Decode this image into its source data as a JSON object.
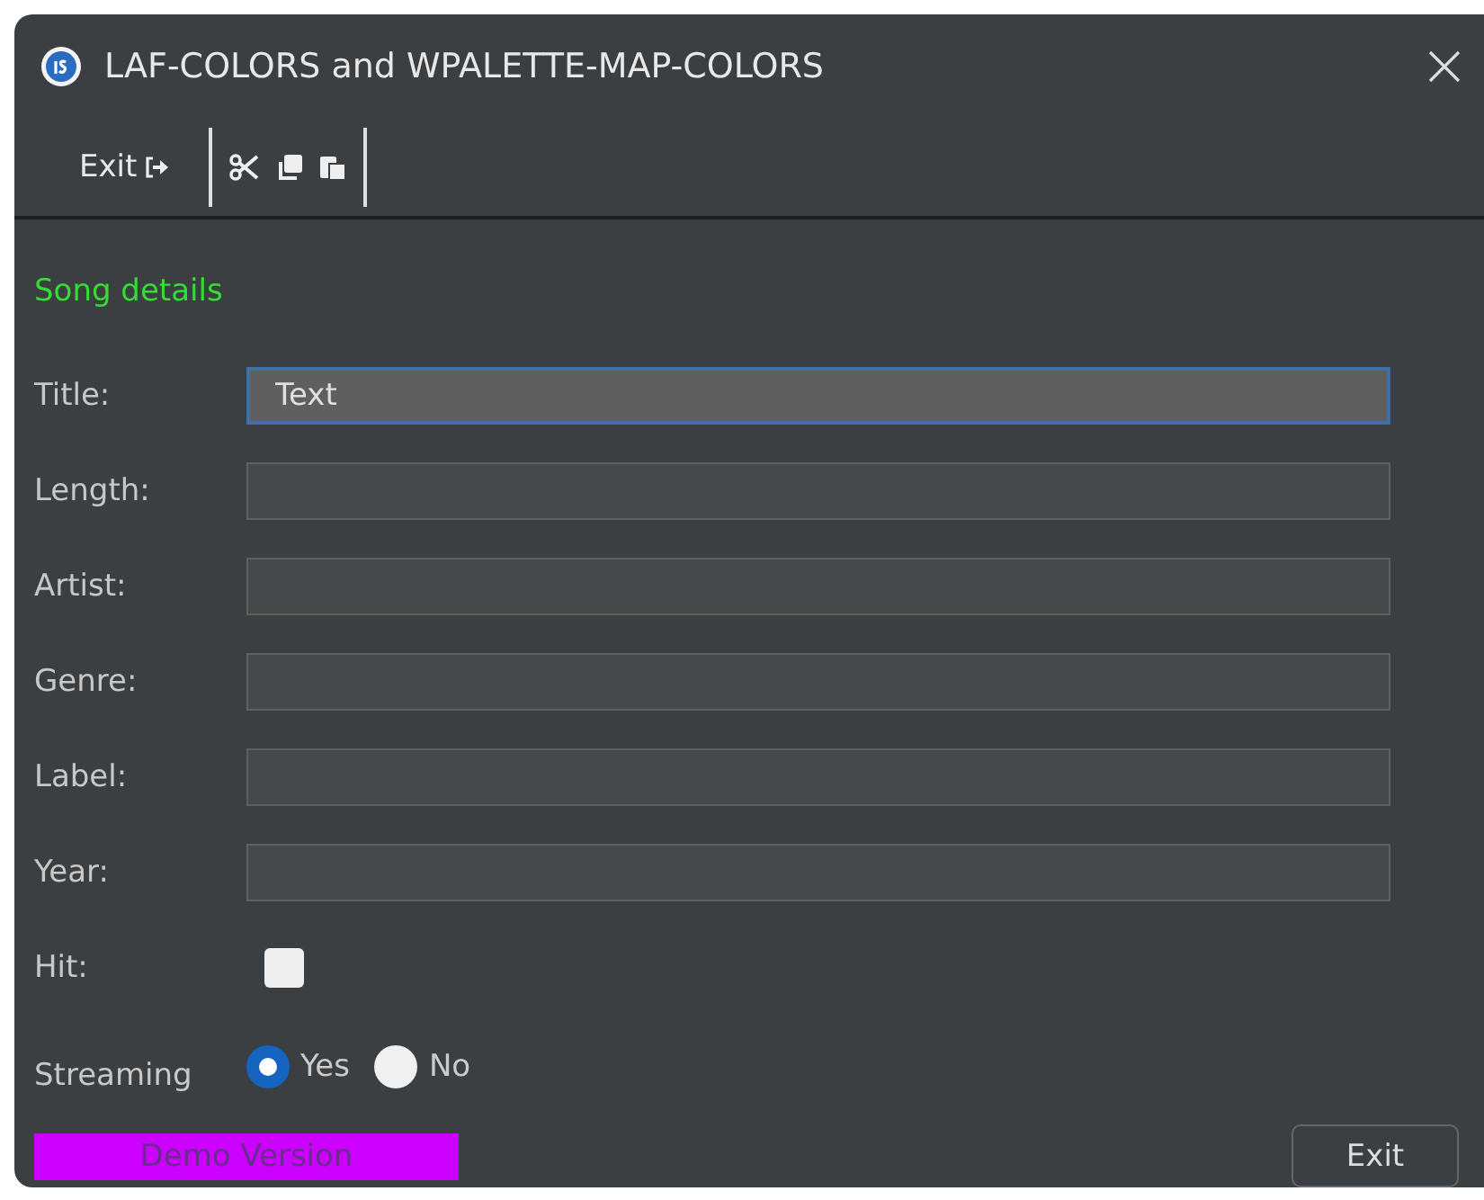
{
  "window": {
    "title": "LAF-COLORS and WPALETTE-MAP-COLORS"
  },
  "toolbar": {
    "exit_label": "Exit"
  },
  "section_title": "Song details",
  "fields": [
    {
      "label": "Title:",
      "value": "Text",
      "focused": true
    },
    {
      "label": "Length:",
      "focused": false
    },
    {
      "label": "Artist:",
      "focused": false
    },
    {
      "label": "Genre:",
      "focused": false
    },
    {
      "label": "Label:",
      "focused": false
    },
    {
      "label": "Year:",
      "focused": false
    }
  ],
  "hit": {
    "label": "Hit:",
    "checked": false
  },
  "streaming": {
    "label": "Streaming",
    "options": [
      {
        "label": "Yes",
        "selected": true
      },
      {
        "label": "No",
        "selected": false
      }
    ]
  },
  "footer": {
    "badge": "Demo Version",
    "button": "Exit"
  }
}
